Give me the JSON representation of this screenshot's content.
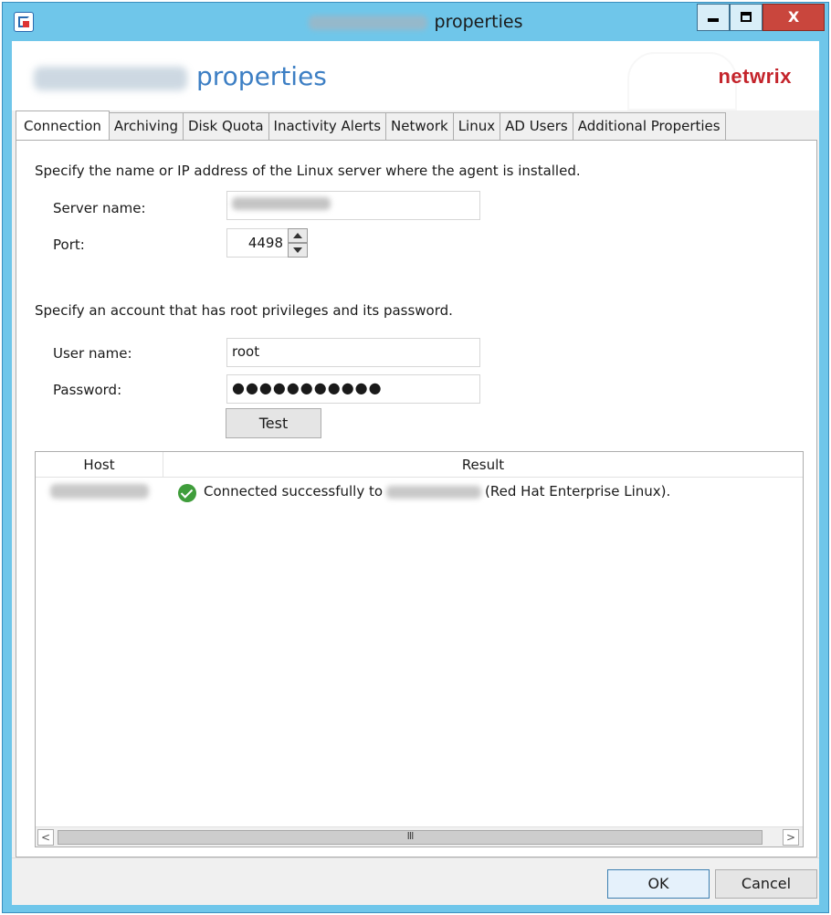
{
  "window": {
    "title": "properties",
    "controls": {
      "minimize_icon": "minimize-icon",
      "maximize_icon": "maximize-icon",
      "close_glyph": "X"
    }
  },
  "header": {
    "title": "properties",
    "brand": "netwrix"
  },
  "tabs": [
    {
      "label": "Connection",
      "active": true
    },
    {
      "label": "Archiving"
    },
    {
      "label": "Disk Quota"
    },
    {
      "label": "Inactivity Alerts"
    },
    {
      "label": "Network"
    },
    {
      "label": "Linux"
    },
    {
      "label": "AD Users"
    },
    {
      "label": "Additional Properties"
    }
  ],
  "connection": {
    "server_intro": "Specify the name or IP address of the Linux server where the agent is installed.",
    "server_name_label": "Server name:",
    "port_label": "Port:",
    "port_value": "4498",
    "account_intro": "Specify an account that has root privileges and its password.",
    "user_name_label": "User name:",
    "user_name_value": "root",
    "password_label": "Password:",
    "password_mask": "●●●●●●●●●●●",
    "test_button": "Test"
  },
  "results": {
    "columns": [
      "Host",
      "Result"
    ],
    "rows": [
      {
        "status_icon": "check-circle-icon",
        "result_prefix": "Connected successfully to",
        "result_suffix": "(Red Hat Enterprise Linux)."
      }
    ],
    "scroll_left_glyph": "<",
    "scroll_right_glyph": ">",
    "scroll_thumb_glyph": "III"
  },
  "footer": {
    "ok_button": "OK",
    "cancel_button": "Cancel"
  },
  "colors": {
    "titlebar": "#6fc6ea",
    "header_title": "#3d7fc4",
    "brand": "#c4242b",
    "close_button": "#c9463d",
    "success": "#3f9d3b"
  }
}
